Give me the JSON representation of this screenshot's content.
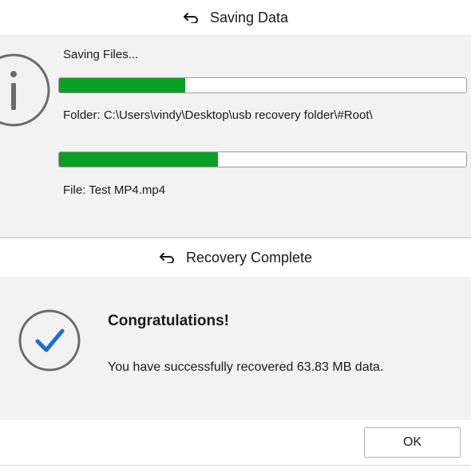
{
  "saving_dialog": {
    "title": "Saving Data",
    "title_icon": "undo-arrow-icon",
    "status_icon": "info-icon",
    "saving_label": "Saving Files...",
    "folder_progress": 0.31,
    "folder_label": "Folder: C:\\Users\\vindy\\Desktop\\usb recovery folder\\#Root\\",
    "file_progress": 0.39,
    "file_label": "File: Test MP4.mp4"
  },
  "complete_dialog": {
    "title": "Recovery Complete",
    "title_icon": "undo-arrow-icon",
    "status_icon": "check-circle-icon",
    "heading": "Congratulations!",
    "message": "You have successfully recovered 63.83 MB data.",
    "ok_label": "OK"
  },
  "colors": {
    "progress_fill": "#0c9f26",
    "check_blue": "#1a6ed8",
    "icon_gray": "#6b6b6b"
  }
}
